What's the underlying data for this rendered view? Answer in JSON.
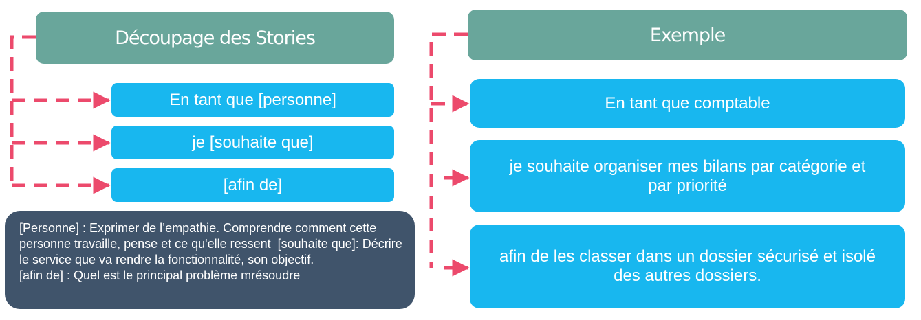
{
  "left": {
    "header": "Découpage des Stories",
    "items": [
      "En tant que [personne]",
      "je [souhaite que]",
      "[afin de]"
    ],
    "note": "[Personne] : Exprimer de l’empathie. Comprendre comment cette personne travaille, pense et ce qu'elle ressent  [souhaite que]: Décrire le service que va rendre la fonctionnalité, son objectif.\n[afin de] : Quel est le principal problème mrésoudre"
  },
  "right": {
    "header": "Exemple",
    "items": [
      "En tant que comptable",
      "je souhaite organiser mes bilans par catégorie et par priorité",
      "afin de les classer dans un dossier sécurisé et isolé des autres dossiers."
    ]
  },
  "colors": {
    "header_bg": "#69a69b",
    "item_bg": "#18b7ef",
    "note_bg": "#40546b",
    "connector": "#ec4a6c"
  }
}
